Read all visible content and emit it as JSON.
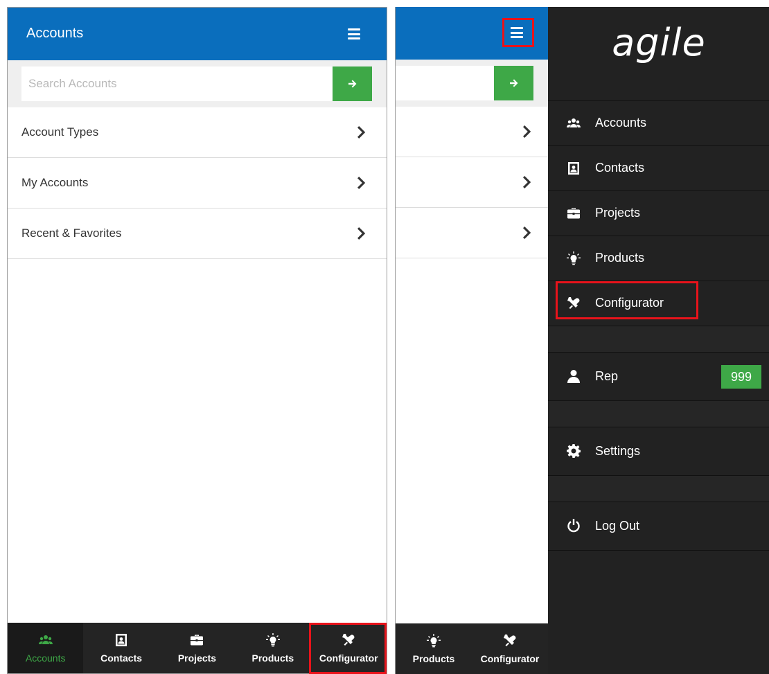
{
  "left": {
    "header": {
      "title": "Accounts",
      "menu_icon": "hamburger-icon"
    },
    "search": {
      "placeholder": "Search Accounts",
      "go_icon": "arrow-right-icon"
    },
    "list": [
      {
        "label": "Account Types"
      },
      {
        "label": "My Accounts"
      },
      {
        "label": "Recent & Favorites"
      }
    ],
    "tabs": [
      {
        "label": "Accounts",
        "icon": "users-icon",
        "active": true
      },
      {
        "label": "Contacts",
        "icon": "contact-card-icon"
      },
      {
        "label": "Projects",
        "icon": "briefcase-icon"
      },
      {
        "label": "Products",
        "icon": "lightbulb-icon"
      },
      {
        "label": "Configurator",
        "icon": "tools-icon"
      }
    ]
  },
  "right": {
    "tabs": [
      {
        "label": "Products",
        "icon": "lightbulb-icon"
      },
      {
        "label": "Configurator",
        "icon": "tools-icon"
      }
    ],
    "drawer": {
      "logo": "agile",
      "menu": [
        {
          "label": "Accounts",
          "icon": "users-icon"
        },
        {
          "label": "Contacts",
          "icon": "contact-card-icon"
        },
        {
          "label": "Projects",
          "icon": "briefcase-icon"
        },
        {
          "label": "Products",
          "icon": "lightbulb-icon"
        },
        {
          "label": "Configurator",
          "icon": "tools-icon"
        }
      ],
      "user": {
        "label": "Rep",
        "icon": "user-icon",
        "badge": "999"
      },
      "settings": {
        "label": "Settings",
        "icon": "gear-icon"
      },
      "logout": {
        "label": "Log Out",
        "icon": "power-icon"
      }
    }
  },
  "colors": {
    "header_blue": "#0a6ebd",
    "go_green": "#3ea847",
    "tabbar_dark": "#242424",
    "drawer_dark": "#222222",
    "highlight_red": "#e8131b"
  }
}
